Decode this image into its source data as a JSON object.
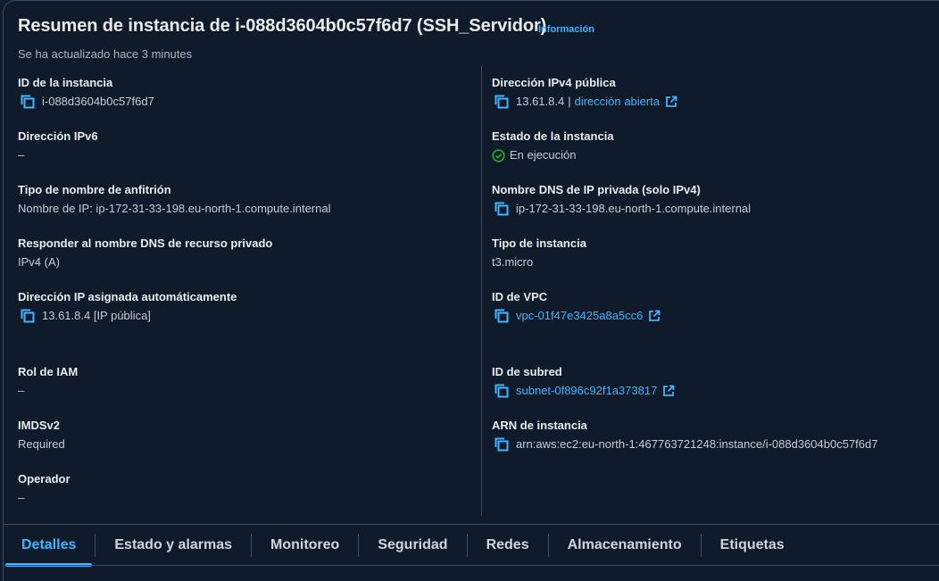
{
  "header": {
    "title": "Resumen de instancia de i-088d3604b0c57f6d7 (SSH_Servidor)",
    "info_link": "Información",
    "updated": "Se ha actualizado hace 3 minutes"
  },
  "left": {
    "instance_id": {
      "label": "ID de la instancia",
      "value": "i-088d3604b0c57f6d7"
    },
    "ipv6": {
      "label": "Dirección IPv6",
      "value": "–"
    },
    "hostname_type": {
      "label": "Tipo de nombre de anfitrión",
      "value": "Nombre de IP: ip-172-31-33-198.eu-north-1.compute.internal"
    },
    "private_dns_answer": {
      "label": "Responder al nombre DNS de recurso privado",
      "value": "IPv4 (A)"
    },
    "auto_ip": {
      "label": "Dirección IP asignada automáticamente",
      "value": "13.61.8.4 [IP pública]"
    },
    "iam_role": {
      "label": "Rol de IAM",
      "value": "–"
    },
    "imdsv2": {
      "label": "IMDSv2",
      "value": "Required"
    },
    "operator": {
      "label": "Operador",
      "value": "–"
    }
  },
  "right": {
    "public_ipv4": {
      "label": "Dirección IPv4 pública",
      "value": "13.61.8.4",
      "link": "dirección abierta"
    },
    "state": {
      "label": "Estado de la instancia",
      "value": "En ejecución"
    },
    "private_dns": {
      "label": "Nombre DNS de IP privada (solo IPv4)",
      "value": "ip-172-31-33-198.eu-north-1.compute.internal"
    },
    "instance_type": {
      "label": "Tipo de instancia",
      "value": "t3.micro"
    },
    "vpc_id": {
      "label": "ID de VPC",
      "value": "vpc-01f47e3425a8a5cc6"
    },
    "subnet_id": {
      "label": "ID de subred",
      "value": "subnet-0f896c92f1a373817"
    },
    "arn": {
      "label": "ARN de instancia",
      "value": "arn:aws:ec2:eu-north-1:467763721248:instance/i-088d3604b0c57f6d7"
    }
  },
  "tabs": [
    {
      "label": "Detalles",
      "active": true
    },
    {
      "label": "Estado y alarmas"
    },
    {
      "label": "Monitoreo"
    },
    {
      "label": "Seguridad"
    },
    {
      "label": "Redes"
    },
    {
      "label": "Almacenamiento"
    },
    {
      "label": "Etiquetas"
    }
  ],
  "colors": {
    "background": "#0f1b2a",
    "link": "#42b4ff",
    "running": "#29ad32",
    "border": "#414d5c"
  },
  "icons": {
    "copy": "copy-icon",
    "external": "external-link-icon",
    "status": "check-circle-icon"
  }
}
